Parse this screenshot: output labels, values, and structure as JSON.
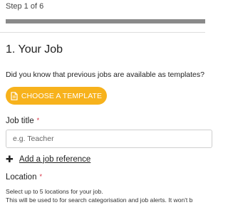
{
  "step": {
    "label": "Step 1 of 6",
    "progress_fraction": 1.0
  },
  "section": {
    "title": "1. Your Job"
  },
  "template": {
    "question": "Did you know that previous jobs are available as templates?",
    "button_label": "CHOOSE A TEMPLATE",
    "button_icon": "document-icon"
  },
  "job_title": {
    "label": "Job title",
    "required_marker": "*",
    "placeholder": "e.g. Teacher",
    "value": ""
  },
  "job_reference": {
    "icon": "plus-icon",
    "link_label": "Add a job reference"
  },
  "location": {
    "label": "Location",
    "required_marker": "*",
    "help_line_1": "Select up to 5 locations for your job.",
    "help_line_2": "This will be used to for search categorisation and job alerts. It won't b"
  },
  "colors": {
    "accent": "#f7b21c",
    "required": "#d6263a",
    "progress": "#8a8a8a"
  }
}
